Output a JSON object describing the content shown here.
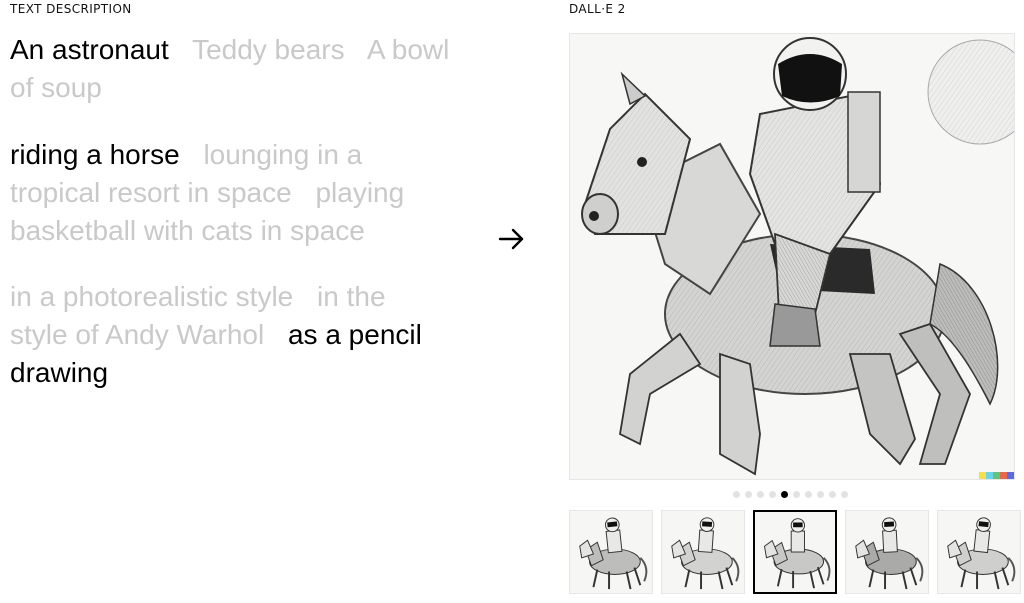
{
  "labels": {
    "left": "TEXT DESCRIPTION",
    "right": "DALL·E 2"
  },
  "prompt": {
    "subject_options": [
      {
        "text": "An astronaut",
        "selected": true
      },
      {
        "text": "Teddy bears",
        "selected": false
      },
      {
        "text": "A bowl of soup",
        "selected": false
      }
    ],
    "action_options": [
      {
        "text": "riding a horse",
        "selected": true
      },
      {
        "text": "lounging in a tropical resort in space",
        "selected": false
      },
      {
        "text": "playing basketball with cats in space",
        "selected": false
      }
    ],
    "style_options": [
      {
        "text": "in a photorealistic style",
        "selected": false
      },
      {
        "text": "in the style of Andy Warhol",
        "selected": false
      },
      {
        "text": "as a pencil drawing",
        "selected": true
      }
    ]
  },
  "arrow_icon": "right-arrow-icon",
  "carousel": {
    "dot_count": 10,
    "active_index": 4
  },
  "thumbnails": {
    "count": 5,
    "selected_index": 2
  },
  "colors": {
    "selected_text": "#000000",
    "unselected_text": "#c9c9c9",
    "watermark": [
      "#f4e04d",
      "#6ad4e8",
      "#63c27a",
      "#e8684a",
      "#5b6be0"
    ]
  }
}
